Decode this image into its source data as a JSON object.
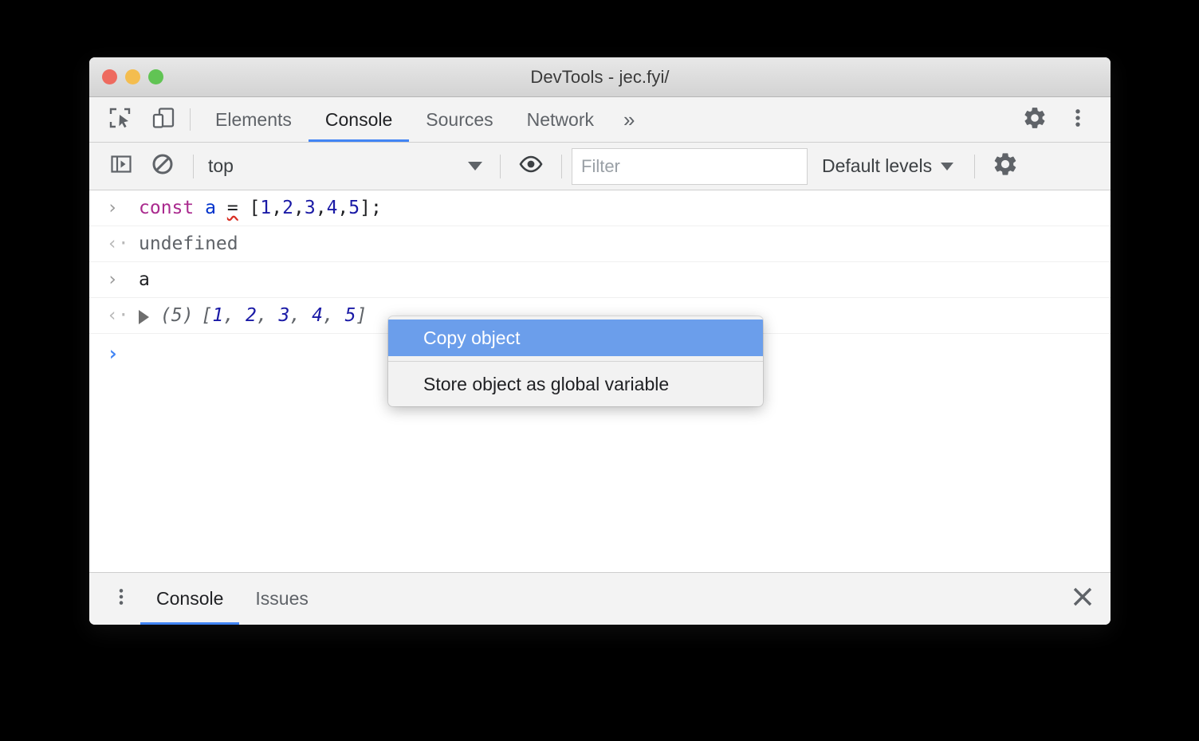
{
  "window": {
    "title": "DevTools - jec.fyi/",
    "traffic_lights": [
      {
        "name": "close",
        "color": "#ee6a5f"
      },
      {
        "name": "minimize",
        "color": "#f4bd4f"
      },
      {
        "name": "maximize",
        "color": "#61c454"
      }
    ]
  },
  "main_tabbar": {
    "icons": [
      {
        "name": "inspect-element-icon"
      },
      {
        "name": "device-toolbar-icon"
      }
    ],
    "tabs": [
      {
        "label": "Elements",
        "active": false
      },
      {
        "label": "Console",
        "active": true
      },
      {
        "label": "Sources",
        "active": false
      },
      {
        "label": "Network",
        "active": false
      }
    ],
    "more_tabs_label": "»",
    "right_icons": [
      {
        "name": "settings-gear-icon"
      },
      {
        "name": "more-options-kebab-icon"
      }
    ]
  },
  "console_toolbar": {
    "sidebar_toggle_icon": "console-sidebar-icon",
    "clear_console_icon": "clear-console-icon",
    "context": {
      "value": "top",
      "caret": "▼"
    },
    "live_expression_icon": "eye-icon",
    "filter": {
      "placeholder": "Filter",
      "value": ""
    },
    "levels": {
      "label": "Default levels",
      "caret": "▼"
    },
    "settings_icon": "console-settings-gear-icon"
  },
  "console_rows": [
    {
      "kind": "input",
      "gutter": "›",
      "text": "const a = [1,2,3,4,5];",
      "tokens": {
        "keyword": "const",
        "space1": " ",
        "variable": "a",
        "space2": " ",
        "equals": "=",
        "space3": " ",
        "rest": "[1,2,3,4,5];",
        "bracket_open": "[",
        "nums": [
          "1",
          "2",
          "3",
          "4",
          "5"
        ],
        "bracket_close": "];"
      }
    },
    {
      "kind": "output",
      "gutter": "‹·",
      "text": "undefined"
    },
    {
      "kind": "input",
      "gutter": "›",
      "text": "a"
    },
    {
      "kind": "output-object",
      "gutter": "‹·",
      "disclosure": "▶",
      "count_label": "(5)",
      "bracket_open": "[",
      "values": [
        "1",
        "2",
        "3",
        "4",
        "5"
      ],
      "separator": ", ",
      "bracket_close": "]",
      "text": "(5) [1, 2, 3, 4, 5]"
    }
  ],
  "prompt": {
    "chevron": "›",
    "value": ""
  },
  "context_menu": {
    "items": [
      {
        "label": "Copy object",
        "highlighted": true
      },
      {
        "label": "Store object as global variable",
        "highlighted": false
      }
    ],
    "highlight_color": "#6b9eeb"
  },
  "drawer": {
    "menu_icon": "drawer-kebab-icon",
    "tabs": [
      {
        "label": "Console",
        "active": true
      },
      {
        "label": "Issues",
        "active": false
      }
    ],
    "close_icon": "close-drawer-icon"
  },
  "colors": {
    "accent": "#4285f4",
    "menu_highlight": "#6b9eeb",
    "keyword": "#aa2a8e",
    "number": "#1a1aa6",
    "variable": "#0033cc",
    "error_squiggle": "#d93025"
  }
}
